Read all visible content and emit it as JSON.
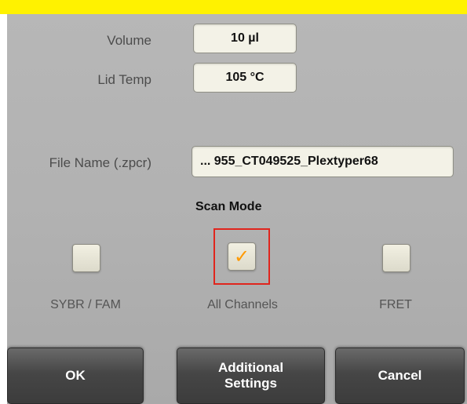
{
  "settings": {
    "volume": {
      "label": "Volume",
      "value": "10 µl"
    },
    "lid_temp": {
      "label": "Lid Temp",
      "value": "105 °C"
    },
    "file_name": {
      "label": "File Name (.zpcr)",
      "value": "... 955_CT049525_Plextyper68"
    }
  },
  "scan_mode": {
    "title": "Scan Mode",
    "options": [
      {
        "label": "SYBR / FAM",
        "checked": false
      },
      {
        "label": "All Channels",
        "checked": true,
        "mark": "✓"
      },
      {
        "label": "FRET",
        "checked": false
      }
    ]
  },
  "buttons": {
    "ok": "OK",
    "additional_line1": "Additional",
    "additional_line2": "Settings",
    "cancel": "Cancel"
  },
  "colors": {
    "top_bar": "#fff200",
    "highlight": "#e0251d",
    "checkmark": "#ff9900"
  }
}
